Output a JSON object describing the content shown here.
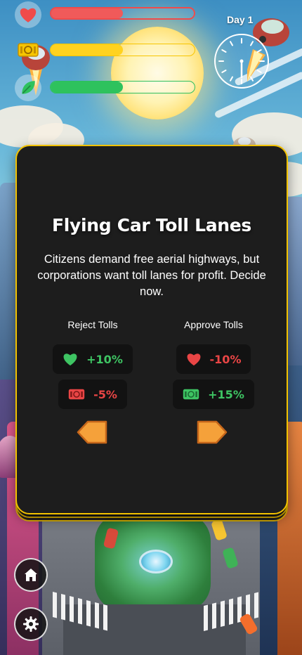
{
  "hud": {
    "health": {
      "icon": "heart-icon",
      "level": 0.5,
      "color": "#f05a5a"
    },
    "money": {
      "icon": "money-icon",
      "level": 0.5,
      "color": "#ffd21f"
    },
    "environment": {
      "icon": "leaf-icon",
      "level": 0.5,
      "color": "#2ec25d"
    },
    "day_label": "Day 1",
    "clock": {
      "icon": "clock-icon"
    }
  },
  "card": {
    "title": "Flying Car Toll Lanes",
    "description": "Citizens demand free aerial highways, but corporations want toll lanes for profit. Decide now.",
    "left_choice": {
      "label": "Reject Tolls",
      "effects": [
        {
          "icon": "heart-icon",
          "value": "+10%",
          "sentiment": "positive"
        },
        {
          "icon": "money-icon",
          "value": "-5%",
          "sentiment": "negative"
        }
      ],
      "arrow_icon": "arrow-left-icon"
    },
    "right_choice": {
      "label": "Approve Tolls",
      "effects": [
        {
          "icon": "heart-icon",
          "value": "-10%",
          "sentiment": "negative"
        },
        {
          "icon": "money-icon",
          "value": "+15%",
          "sentiment": "positive"
        }
      ],
      "arrow_icon": "arrow-right-icon"
    }
  },
  "nav": {
    "home_icon": "home-icon",
    "settings_icon": "gear-icon"
  },
  "colors": {
    "card_border": "#f2c200",
    "positive": "#3ec463",
    "negative": "#e94545",
    "arrow": "#f5a13a"
  }
}
